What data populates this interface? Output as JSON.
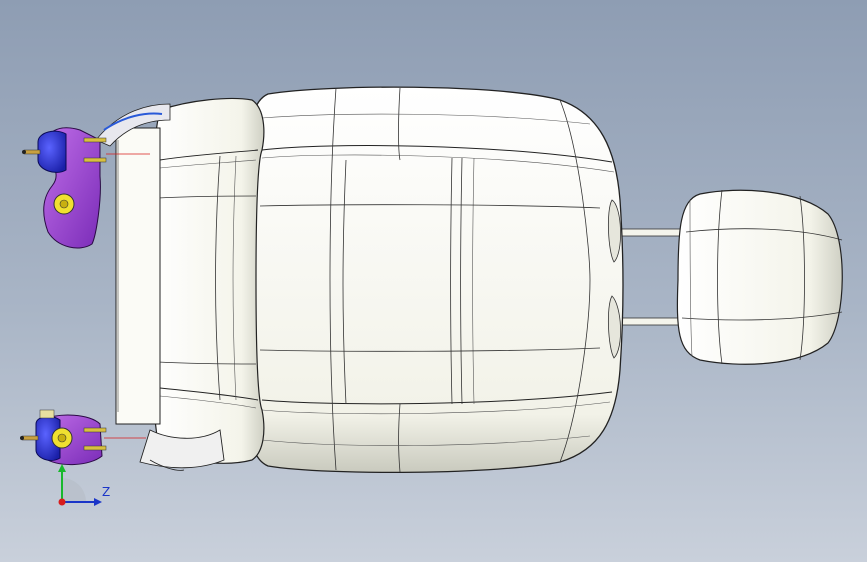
{
  "viewport": {
    "background_top": "#8e9db3",
    "background_bottom": "#c9d0db"
  },
  "model": {
    "parts": [
      "seat-cushion",
      "seat-back",
      "headrest",
      "headrest-posts",
      "side-trim",
      "recliner-bracket-upper",
      "recliner-bracket-lower"
    ],
    "surface_color": "#fafaf3",
    "edge_color": "#2a2a2a",
    "bracket_color": "#9a3fd6",
    "motor_color": "#2a2fd8"
  },
  "triad": {
    "z_label": "Z",
    "axis_colors": {
      "z": "#1a35c8",
      "y": "#18b82c",
      "x": "#d81c1c"
    }
  }
}
